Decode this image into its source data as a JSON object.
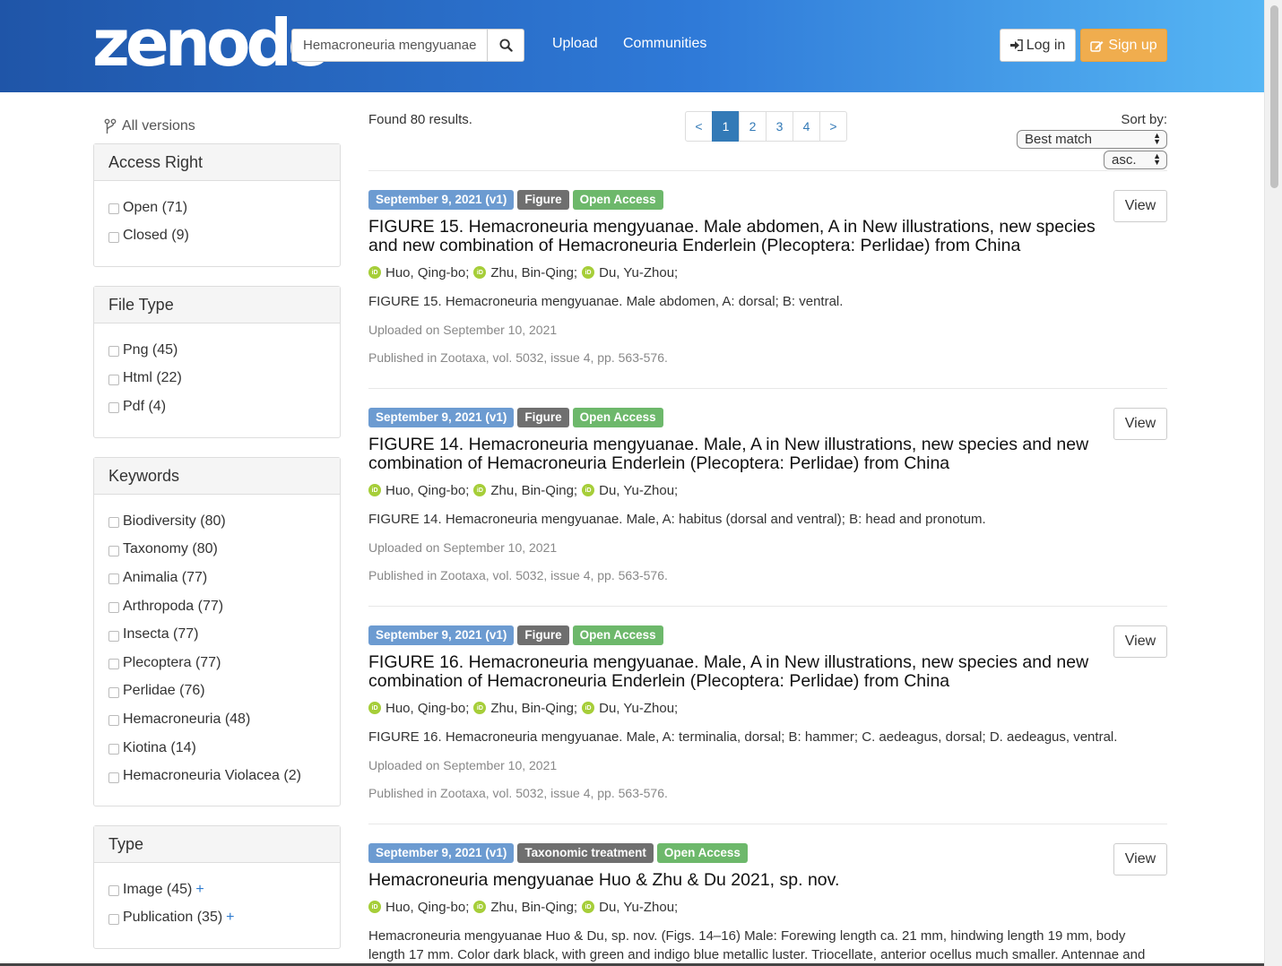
{
  "header": {
    "logo_text": "zenodo",
    "search_value": "Hemacroneuria mengyuanae",
    "nav": [
      "Upload",
      "Communities"
    ],
    "login_label": "Log in",
    "signup_label": "Sign up"
  },
  "sidebar": {
    "all_versions_label": "All versions",
    "facets": [
      {
        "title": "Access Right",
        "items": [
          "Open (71)",
          "Closed (9)"
        ]
      },
      {
        "title": "File Type",
        "items": [
          "Png (45)",
          "Html (22)",
          "Pdf (4)"
        ]
      },
      {
        "title": "Keywords",
        "items": [
          "Biodiversity (80)",
          "Taxonomy (80)",
          "Animalia (77)",
          "Arthropoda (77)",
          "Insecta (77)",
          "Plecoptera (77)",
          "Perlidae (76)",
          "Hemacroneuria (48)",
          "Kiotina (14)",
          "Hemacroneuria Violacea (2)"
        ]
      },
      {
        "title": "Type",
        "items": [
          "Image (45)",
          "Publication (35)"
        ],
        "expand": "+"
      }
    ]
  },
  "results_header": {
    "found_text": "Found 80 results.",
    "pages": [
      "<",
      "1",
      "2",
      "3",
      "4",
      ">"
    ],
    "active_page": "1",
    "sort_label": "Sort by:",
    "sort_value": "Best match",
    "order_value": "asc."
  },
  "results": [
    {
      "date_badge": "September 9, 2021 (v1)",
      "type_badge": "Figure",
      "access_badge": "Open Access",
      "title": "FIGURE 15. Hemacroneuria mengyuanae. Male abdomen, A in New illustrations, new species and new combination of Hemacroneuria Enderlein (Plecoptera: Perlidae) from China",
      "authors": [
        "Huo, Qing-bo;",
        "Zhu, Bin-Qing;",
        "Du, Yu-Zhou;"
      ],
      "description": "FIGURE 15. Hemacroneuria mengyuanae. Male abdomen, A: dorsal; B: ventral.",
      "uploaded": "Uploaded on September 10, 2021",
      "published": "Published in Zootaxa, vol. 5032, issue 4, pp. 563-576.",
      "view_label": "View"
    },
    {
      "date_badge": "September 9, 2021 (v1)",
      "type_badge": "Figure",
      "access_badge": "Open Access",
      "title": "FIGURE 14. Hemacroneuria mengyuanae. Male, A in New illustrations, new species and new combination of Hemacroneuria Enderlein (Plecoptera: Perlidae) from China",
      "authors": [
        "Huo, Qing-bo;",
        "Zhu, Bin-Qing;",
        "Du, Yu-Zhou;"
      ],
      "description": "FIGURE 14. Hemacroneuria mengyuanae. Male, A: habitus (dorsal and ventral); B: head and pronotum.",
      "uploaded": "Uploaded on September 10, 2021",
      "published": "Published in Zootaxa, vol. 5032, issue 4, pp. 563-576.",
      "view_label": "View"
    },
    {
      "date_badge": "September 9, 2021 (v1)",
      "type_badge": "Figure",
      "access_badge": "Open Access",
      "title": "FIGURE 16. Hemacroneuria mengyuanae. Male, A in New illustrations, new species and new combination of Hemacroneuria Enderlein (Plecoptera: Perlidae) from China",
      "authors": [
        "Huo, Qing-bo;",
        "Zhu, Bin-Qing;",
        "Du, Yu-Zhou;"
      ],
      "description": "FIGURE 16. Hemacroneuria mengyuanae. Male, A: terminalia, dorsal; B: hammer; C. aedeagus, dorsal; D. aedeagus, ventral.",
      "uploaded": "Uploaded on September 10, 2021",
      "published": "Published in Zootaxa, vol. 5032, issue 4, pp. 563-576.",
      "view_label": "View"
    },
    {
      "date_badge": "September 9, 2021 (v1)",
      "type_badge": "Taxonomic treatment",
      "access_badge": "Open Access",
      "title": "Hemacroneuria mengyuanae Huo & Zhu & Du 2021, sp. nov.",
      "authors": [
        "Huo, Qing-bo;",
        "Zhu, Bin-Qing;",
        "Du, Yu-Zhou;"
      ],
      "description": "Hemacroneuria mengyuanae Huo & Du, sp. nov. (Figs. 14–16) Male: Forewing length ca. 21 mm, hindwing length 19 mm, body length 17 mm. Color dark black, with green and indigo blue metallic luster. Triocellate, anterior ocellus much smaller. Antennae and",
      "view_label": "View"
    }
  ],
  "icons": {
    "orcid": "orcid-icon",
    "search": "search-icon",
    "login": "sign-in-icon",
    "signup": "edit-icon",
    "versions": "branch-icon"
  },
  "colors": {
    "header_start": "#1f55a8",
    "header_end": "#56b6f4",
    "date_badge": "#6c9bd1",
    "type_badge": "#6f6f6f",
    "access_badge": "#6db86b",
    "signup": "#f0ad4e",
    "orcid": "#a6ce39"
  }
}
